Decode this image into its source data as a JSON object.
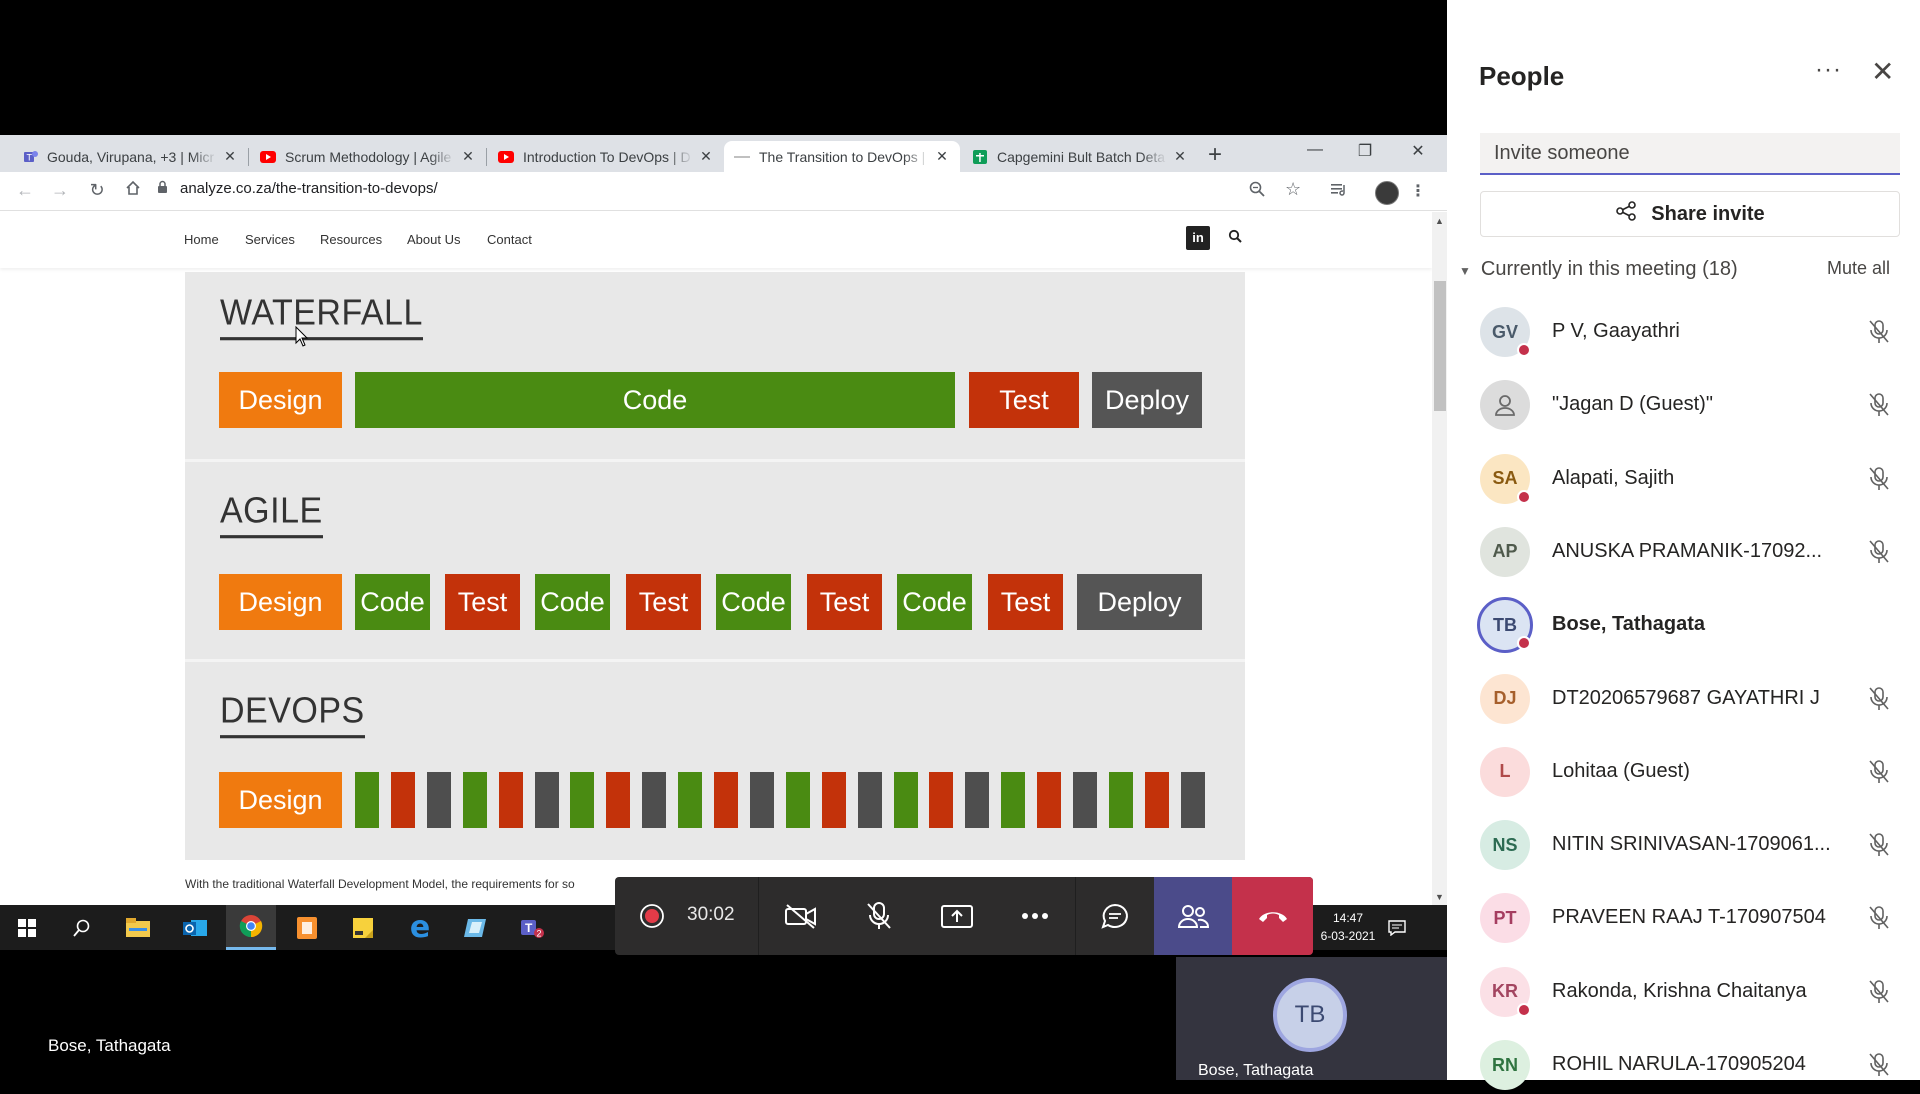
{
  "browser": {
    "tabs": [
      {
        "label": "Gouda, Virupana, +3 | Micr",
        "favicon": "teams-icon"
      },
      {
        "label": "Scrum Methodology | Agile",
        "favicon": "youtube-icon"
      },
      {
        "label": "Introduction To DevOps | D",
        "favicon": "youtube-icon"
      },
      {
        "label": "The Transition to DevOps |",
        "favicon": "page-icon",
        "active": true
      },
      {
        "label": "Capgemini Bult Batch Deta",
        "favicon": "sheets-icon"
      }
    ],
    "url": "analyze.co.za/the-transition-to-devops/"
  },
  "site": {
    "nav": [
      "Home",
      "Services",
      "Resources",
      "About Us",
      "Contact"
    ],
    "linkedin": "in"
  },
  "figure": {
    "waterfall": {
      "heading": "WATERFALL",
      "blocks": [
        {
          "label": "Design",
          "kind": "design"
        },
        {
          "label": "Code",
          "kind": "code"
        },
        {
          "label": "Test",
          "kind": "test"
        },
        {
          "label": "Deploy",
          "kind": "deploy"
        }
      ]
    },
    "agile": {
      "heading": "AGILE",
      "blocks": [
        "Design",
        "Code",
        "Test",
        "Code",
        "Test",
        "Code",
        "Test",
        "Code",
        "Test",
        "Deploy"
      ]
    },
    "devops": {
      "heading": "DEVOPS",
      "design": "Design",
      "stripes": [
        "code",
        "test",
        "gray",
        "code",
        "test",
        "gray",
        "code",
        "test",
        "gray",
        "code",
        "test",
        "gray",
        "code",
        "test",
        "gray",
        "code",
        "test",
        "gray",
        "code",
        "test",
        "gray",
        "code",
        "test",
        "gray"
      ]
    },
    "colors": {
      "design": "#f07a0f",
      "code": "#4a8b12",
      "test": "#c3320a",
      "deploy": "#555555"
    }
  },
  "paragraph": "With the traditional Waterfall Development Model, the requirements for so",
  "taskbar": {
    "time": "14:47",
    "date": "6-03-2021"
  },
  "meeting": {
    "timer": "30:02"
  },
  "self": {
    "name": "Bose, Tathagata",
    "initials": "TB",
    "tile_name": "Bose, Tathagata"
  },
  "people": {
    "title": "People",
    "invite_placeholder": "Invite someone",
    "share_label": "Share invite",
    "section_label": "Currently in this meeting (18)",
    "mute_all": "Mute all",
    "list": [
      {
        "initials": "GV",
        "name": "P V, Gaayathri",
        "bg": "#dde3e8",
        "fg": "#4a5a6a",
        "badge": true
      },
      {
        "initials": "",
        "name": "\"Jagan D (Guest)\"",
        "bg": "#dcdcdc",
        "fg": "#6a6a6a",
        "guest": true
      },
      {
        "initials": "SA",
        "name": "Alapati, Sajith",
        "bg": "#fbe6c2",
        "fg": "#8a5a10",
        "badge": true
      },
      {
        "initials": "AP",
        "name": "ANUSKA PRAMANIK-17092...",
        "bg": "#e0e4de",
        "fg": "#4f5a4c"
      },
      {
        "initials": "TB",
        "name": "Bose, Tathagata",
        "bg": "#dbe4f3",
        "fg": "#3c4a72",
        "bold": true,
        "self": true
      },
      {
        "initials": "DJ",
        "name": "DT20206579687 GAYATHRI J",
        "bg": "#fde5d2",
        "fg": "#a65f2c"
      },
      {
        "initials": "L",
        "name": "Lohitaa (Guest)",
        "bg": "#fbdcdc",
        "fg": "#b04a4a"
      },
      {
        "initials": "NS",
        "name": "NITIN SRINIVASAN-1709061...",
        "bg": "#d7ece3",
        "fg": "#2c6b52"
      },
      {
        "initials": "PT",
        "name": "PRAVEEN RAAJ T-170907504",
        "bg": "#fbdde6",
        "fg": "#a53d60"
      },
      {
        "initials": "KR",
        "name": "Rakonda, Krishna Chaitanya",
        "bg": "#fbe0e6",
        "fg": "#a34560",
        "badge": true
      },
      {
        "initials": "RN",
        "name": "ROHIL NARULA-170905204",
        "bg": "#ddf0e0",
        "fg": "#2f7440"
      }
    ]
  }
}
